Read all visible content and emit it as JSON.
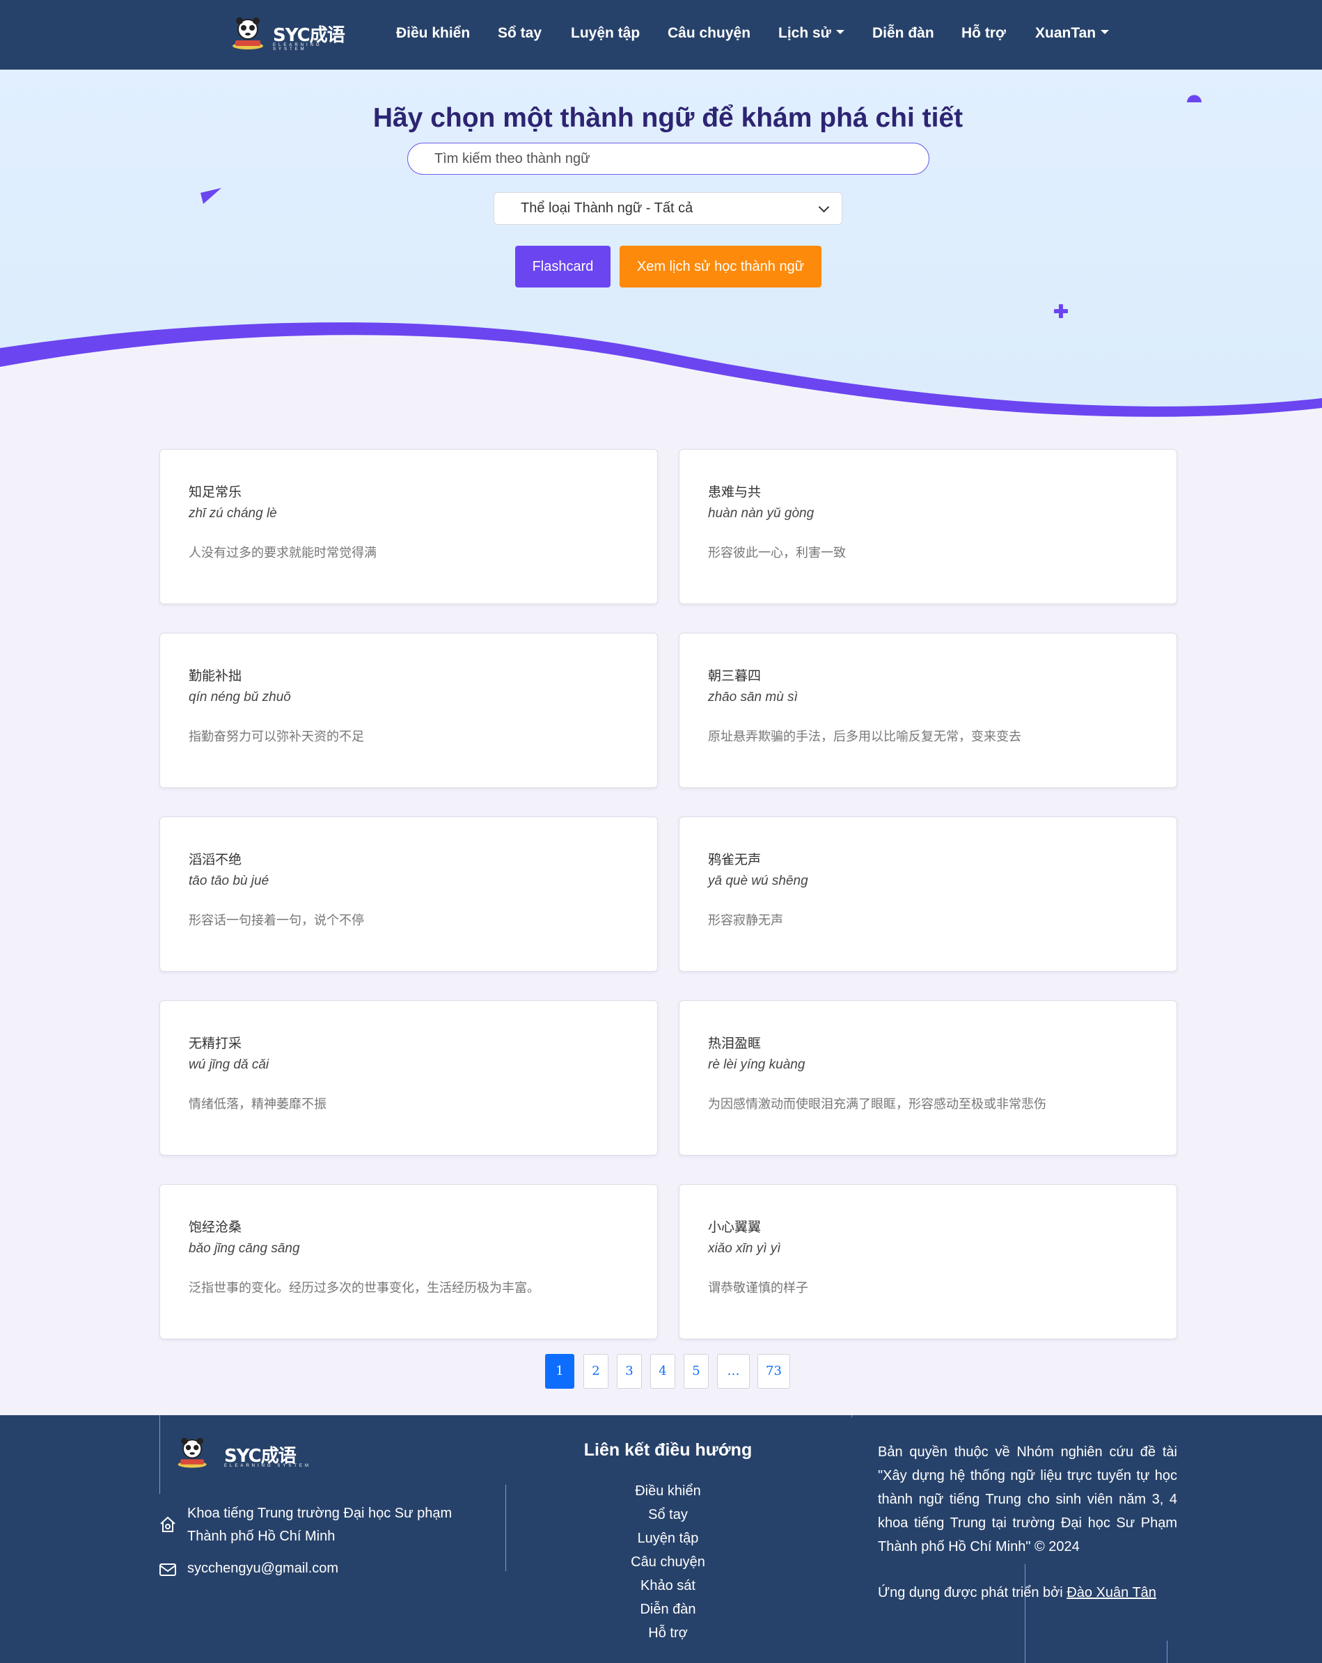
{
  "nav": {
    "brand": "SYC成语",
    "brand_sub": "ELEARNING SYSTEM",
    "items": [
      "Điều khiển",
      "Sổ tay",
      "Luyện tập",
      "Câu chuyện",
      "Lịch sử",
      "Diễn đàn",
      "Hỗ trợ",
      "XuanTan"
    ]
  },
  "hero": {
    "title": "Hãy chọn một thành ngữ để khám phá chi tiết",
    "search_placeholder": "Tìm kiếm theo thành ngữ",
    "category_select": "Thể loại Thành ngữ - Tất cả",
    "flashcard_button": "Flashcard",
    "history_button": "Xem lịch sử học thành ngữ"
  },
  "idioms": [
    {
      "hanzi": "知足常乐",
      "pinyin": "zhī zú cháng lè",
      "meaning": "人没有过多的要求就能时常觉得满"
    },
    {
      "hanzi": "患难与共",
      "pinyin": "huàn nàn yǔ gòng",
      "meaning": "形容彼此一心，利害一致"
    },
    {
      "hanzi": "勤能补拙",
      "pinyin": "qín néng bǔ zhuō",
      "meaning": "指勤奋努力可以弥补天资的不足"
    },
    {
      "hanzi": "朝三暮四",
      "pinyin": "zhāo sān mù sì",
      "meaning": "原址悬弄欺骗的手法，后多用以比喻反复无常，变来变去"
    },
    {
      "hanzi": "滔滔不绝",
      "pinyin": "tāo tāo bù jué",
      "meaning": "形容话一句接着一句，说个不停"
    },
    {
      "hanzi": "鸦雀无声",
      "pinyin": "yā què wú shēng",
      "meaning": "形容寂静无声"
    },
    {
      "hanzi": "无精打采",
      "pinyin": "wú jīng dǎ cǎi",
      "meaning": "情绪低落，精神萎靡不振"
    },
    {
      "hanzi": "热泪盈眶",
      "pinyin": "rè lèi yíng kuàng",
      "meaning": "为因感情激动而使眼泪充满了眼眶，形容感动至极或非常悲伤"
    },
    {
      "hanzi": "饱经沧桑",
      "pinyin": "bǎo jīng cāng sāng",
      "meaning": "泛指世事的变化。经历过多次的世事变化，生活经历极为丰富。"
    },
    {
      "hanzi": "小心翼翼",
      "pinyin": "xiǎo xīn yì yì",
      "meaning": "谓恭敬谨慎的样子"
    }
  ],
  "pagination": {
    "pages": [
      "1",
      "2",
      "3",
      "4",
      "5",
      "…",
      "73"
    ],
    "active": "1"
  },
  "footer": {
    "address": "Khoa tiếng Trung trường Đại học Sư phạm Thành phố Hồ Chí Minh",
    "email": "sycchengyu@gmail.com",
    "links_heading": "Liên kết điều hướng",
    "links": [
      "Điều khiển",
      "Sổ tay",
      "Luyện tập",
      "Câu chuyện",
      "Khảo sát",
      "Diễn đàn",
      "Hỗ trợ"
    ],
    "copyright": "Bản quyền thuộc về Nhóm nghiên cứu đề tài \"Xây dựng hệ thống ngữ liệu trực tuyến tự học thành ngữ tiếng Trung cho sinh viên năm 3, 4 khoa tiếng Trung tại trường Đại học Sư Phạm Thành phố Hồ Chí Minh\" © 2024",
    "developed_by": "Ứng dụng được phát triển bởi",
    "developer": "Đào Xuân Tân"
  },
  "colors": {
    "navbar": "#27426a",
    "primary": "#6b45f0",
    "accent": "#fd8a0a",
    "page_active": "#0d6efd"
  }
}
